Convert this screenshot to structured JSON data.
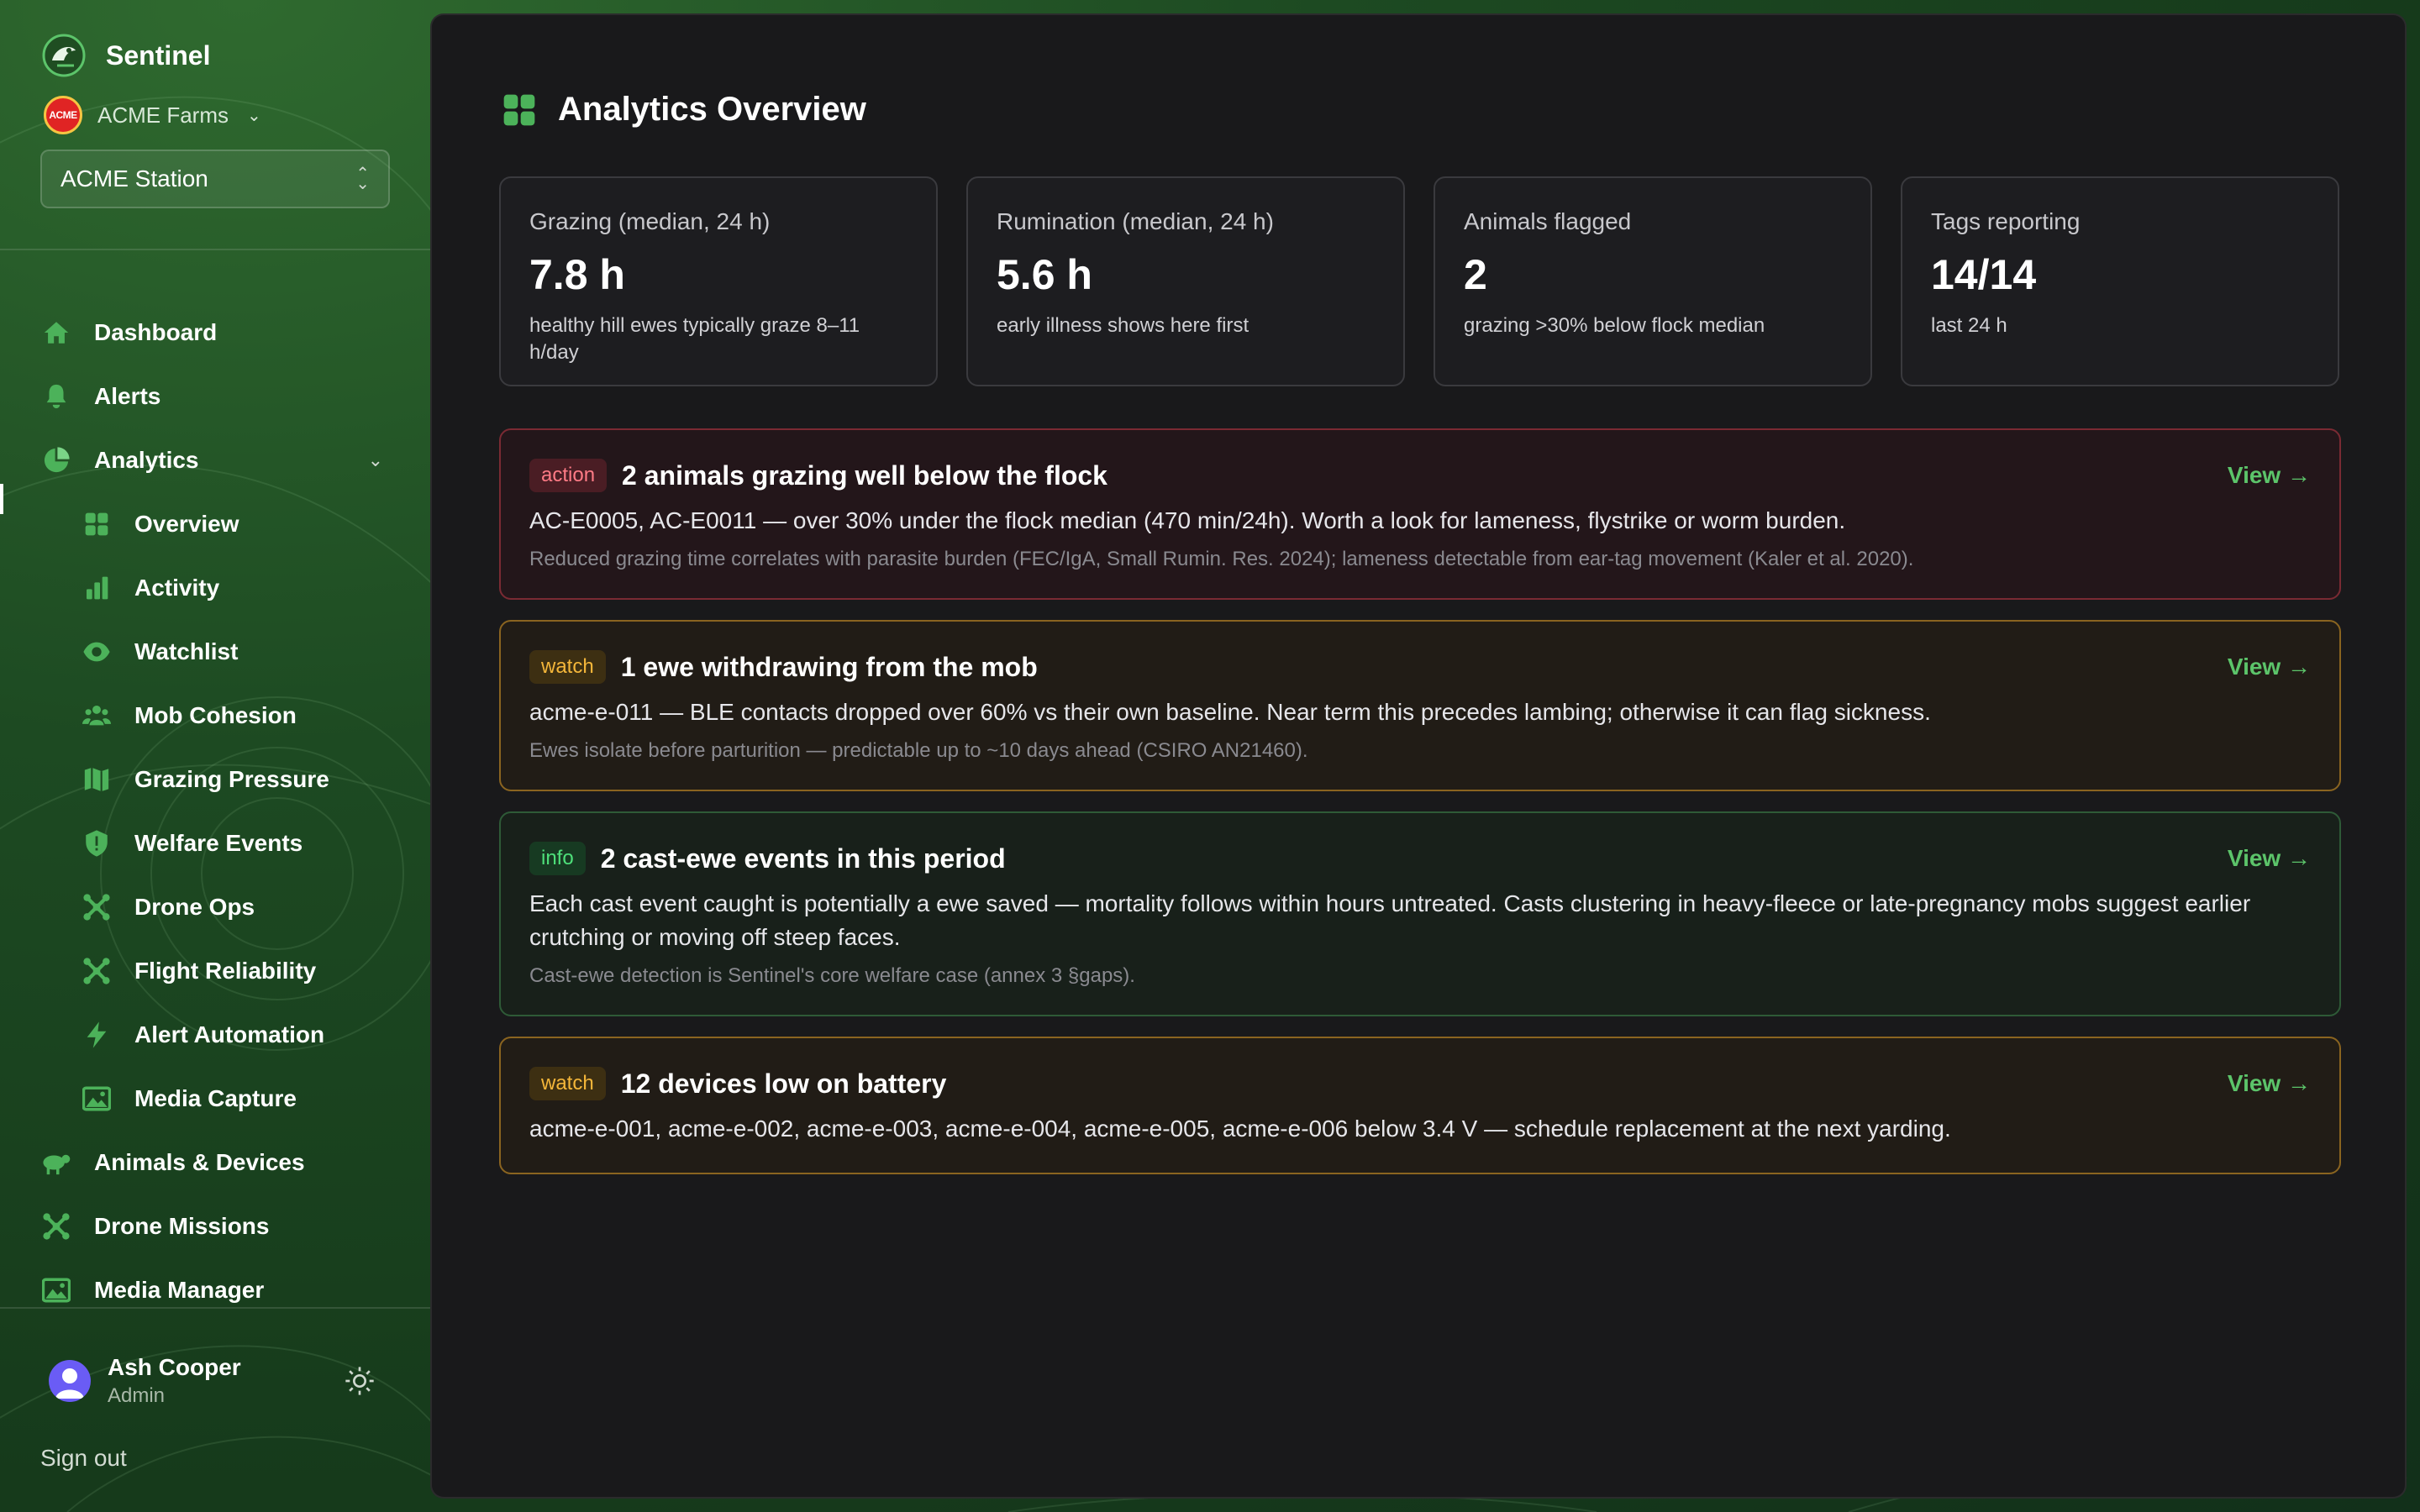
{
  "app": {
    "name": "Sentinel"
  },
  "org": {
    "name": "ACME Farms",
    "logo_text": "ACME"
  },
  "station": {
    "selected": "ACME Station"
  },
  "nav": {
    "dashboard": "Dashboard",
    "alerts": "Alerts",
    "analytics": "Analytics",
    "analytics_sub": {
      "overview": "Overview",
      "activity": "Activity",
      "watchlist": "Watchlist",
      "mob_cohesion": "Mob Cohesion",
      "grazing_pressure": "Grazing Pressure",
      "welfare_events": "Welfare Events",
      "drone_ops": "Drone Ops",
      "flight_reliability": "Flight Reliability",
      "alert_automation": "Alert Automation",
      "media_capture": "Media Capture"
    },
    "animals_devices": "Animals & Devices",
    "drone_missions": "Drone Missions",
    "media_manager": "Media Manager"
  },
  "user": {
    "name": "Ash Cooper",
    "role": "Admin",
    "signout": "Sign out"
  },
  "page": {
    "title": "Analytics Overview"
  },
  "stats": [
    {
      "label": "Grazing (median, 24 h)",
      "value": "7.8 h",
      "note": "healthy hill ewes typically graze 8–11 h/day"
    },
    {
      "label": "Rumination (median, 24 h)",
      "value": "5.6 h",
      "note": "early illness shows here first"
    },
    {
      "label": "Animals flagged",
      "value": "2",
      "note": "grazing >30% below flock median"
    },
    {
      "label": "Tags reporting",
      "value": "14/14",
      "note": "last 24 h"
    }
  ],
  "cards": [
    {
      "level": "action",
      "title": "2 animals grazing well below the flock",
      "body": "AC-E0005, AC-E0011 — over 30% under the flock median (470 min/24h). Worth a look for lameness, flystrike or worm burden.",
      "ref": "Reduced grazing time correlates with parasite burden (FEC/IgA, Small Rumin. Res. 2024); lameness detectable from ear-tag movement (Kaler et al. 2020).",
      "view": "View →"
    },
    {
      "level": "watch",
      "title": "1 ewe withdrawing from the mob",
      "body": "acme-e-011 — BLE contacts dropped over 60% vs their own baseline. Near term this precedes lambing; otherwise it can flag sickness.",
      "ref": "Ewes isolate before parturition — predictable up to ~10 days ahead (CSIRO AN21460).",
      "view": "View →"
    },
    {
      "level": "info",
      "title": "2 cast-ewe events in this period",
      "body": "Each cast event caught is potentially a ewe saved — mortality follows within hours untreated. Casts clustering in heavy-fleece or late-pregnancy mobs suggest earlier crutching or moving off steep faces.",
      "ref": "Cast-ewe detection is Sentinel's core welfare case (annex 3 §gaps).",
      "view": "View →"
    },
    {
      "level": "watch",
      "title": "12 devices low on battery",
      "body": "acme-e-001, acme-e-002, acme-e-003, acme-e-004, acme-e-005, acme-e-006 below 3.4 V — schedule replacement at the next yarding.",
      "view": "View →"
    }
  ],
  "colors": {
    "accent": "#3fae4a",
    "action": "#ff7b86",
    "watch": "#f4b63a",
    "info": "#4ee07a"
  }
}
